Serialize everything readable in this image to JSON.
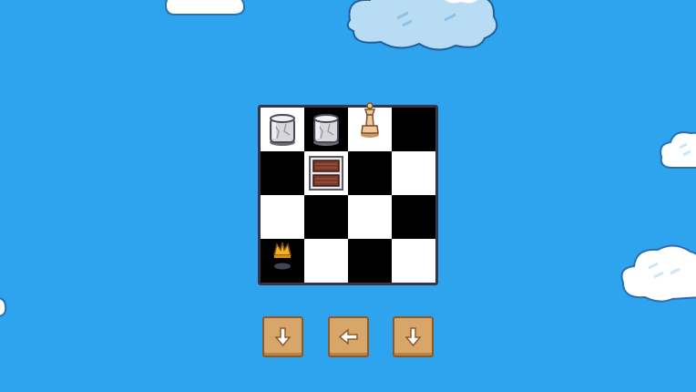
{
  "game": {
    "board": {
      "size": 4,
      "rows": [
        [
          {
            "piece": "barrel"
          },
          {
            "piece": "barrel"
          },
          {
            "piece": "queen"
          },
          {
            "piece": ""
          }
        ],
        [
          {
            "piece": ""
          },
          {
            "piece": "crate"
          },
          {
            "piece": ""
          },
          {
            "piece": ""
          }
        ],
        [
          {
            "piece": ""
          },
          {
            "piece": ""
          },
          {
            "piece": ""
          },
          {
            "piece": ""
          }
        ],
        [
          {
            "piece": "crown-goal"
          },
          {
            "piece": ""
          },
          {
            "piece": ""
          },
          {
            "piece": ""
          }
        ]
      ]
    },
    "move_buttons": [
      {
        "direction": "down",
        "icon": "arrow-down-icon"
      },
      {
        "direction": "left",
        "icon": "arrow-left-icon"
      },
      {
        "direction": "down",
        "icon": "arrow-down-icon"
      }
    ]
  },
  "colors": {
    "sky": "#2ea3ee",
    "board_light": "#ffffff",
    "board_dark": "#000000",
    "board_frame": "#3a3344",
    "button": "#d9a66a",
    "button_border": "#8a5a2b",
    "queen": "#f3c79a",
    "crown": "#f6b21c"
  }
}
